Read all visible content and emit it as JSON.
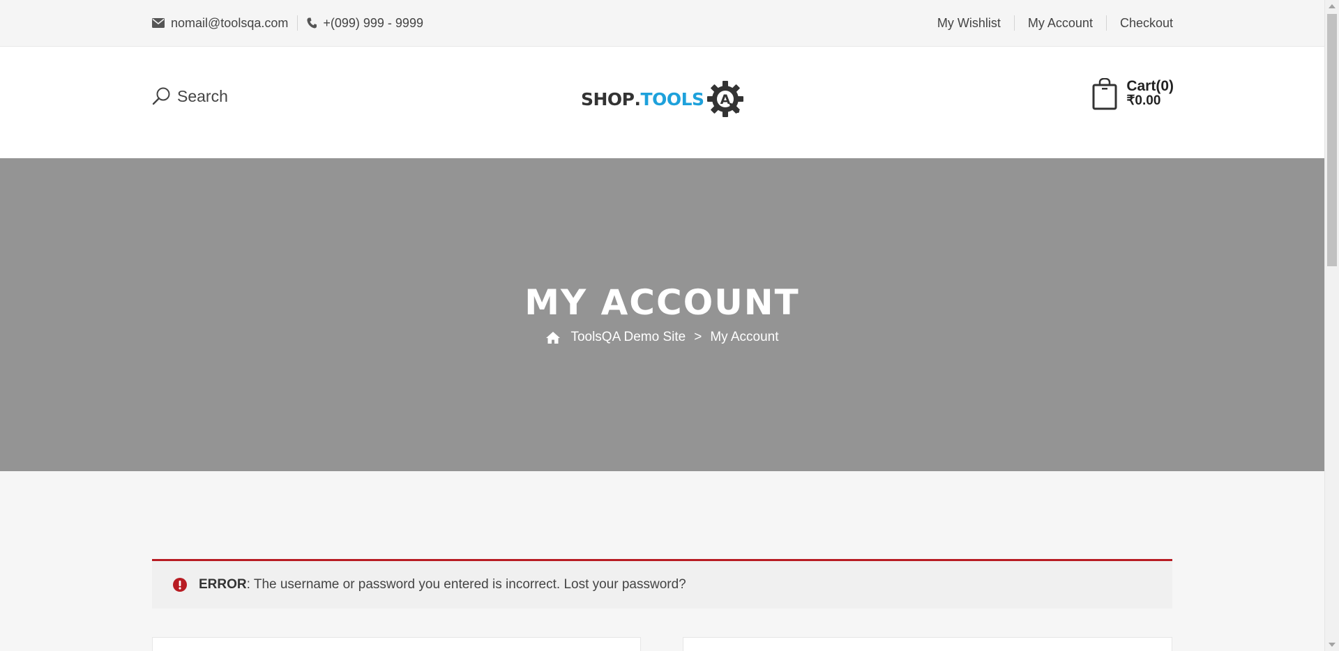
{
  "topbar": {
    "email": "nomail@toolsqa.com",
    "phone": "+(099) 999 - 9999",
    "links": [
      "My Wishlist",
      "My Account",
      "Checkout"
    ],
    "email_icon": "envelope-icon",
    "phone_icon": "phone-icon"
  },
  "header": {
    "search_label": "Search",
    "search_icon": "search-icon",
    "logo": {
      "shop": "SHOP",
      "dot": ".",
      "tools": "TOOLS",
      "mark": "A"
    },
    "cart": {
      "label": "Cart(0)",
      "amount": "₹0.00",
      "icon": "shopping-bag-icon"
    }
  },
  "hero": {
    "title": "MY ACCOUNT",
    "breadcrumb": {
      "home_icon": "home-icon",
      "site": "ToolsQA Demo Site",
      "separator": ">",
      "current": "My Account"
    }
  },
  "error": {
    "icon": "exclamation-circle-icon",
    "label": "ERROR",
    "message": ": The username or password you entered is incorrect. Lost your password?"
  },
  "colors": {
    "accent_blue": "#1ea1db",
    "error_red": "#b81c23",
    "hero_gray": "#949494"
  }
}
